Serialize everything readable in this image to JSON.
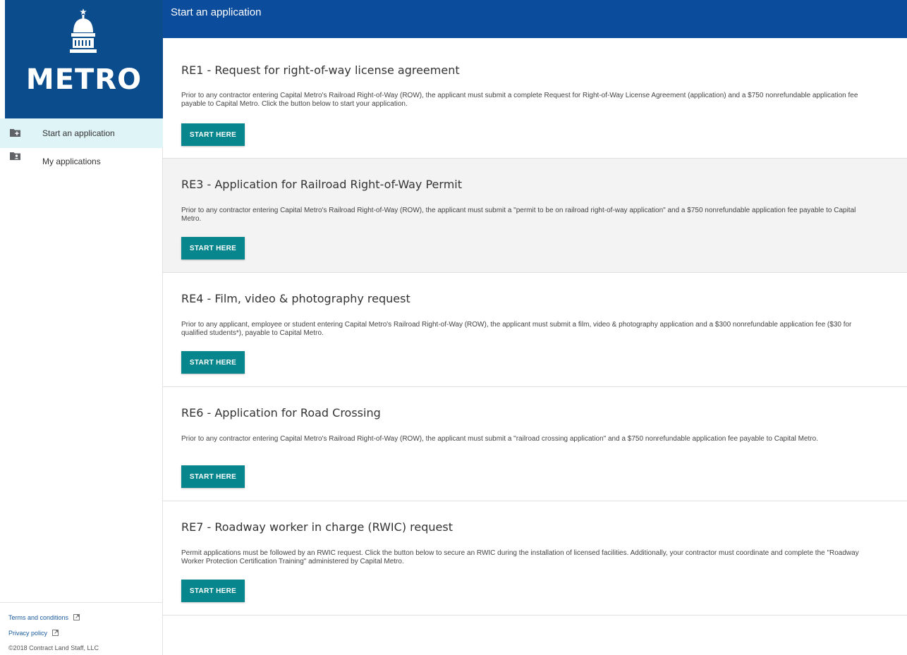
{
  "brand": {
    "logo_text": "METRO",
    "logo_color": "#0b4c8c"
  },
  "header": {
    "title": "Start an application",
    "color": "#0b4c9c"
  },
  "sidebar": {
    "items": [
      {
        "label": "Start an application",
        "icon": "folder-plus-icon",
        "active": true
      },
      {
        "label": "My applications",
        "icon": "folder-user-icon",
        "active": false
      }
    ],
    "footer": {
      "terms_label": "Terms and conditions",
      "privacy_label": "Privacy policy",
      "copyright": "©2018 Contract Land Staff, LLC"
    }
  },
  "applications": [
    {
      "title": "RE1 - Request for right-of-way license agreement",
      "description": "Prior to any contractor entering Capital Metro's Railroad Right-of-Way (ROW), the applicant must submit a complete Request for Right-of-Way License Agreement (application) and a $750 nonrefundable application fee payable to Capital Metro. Click the button below to start your application.",
      "button_label": "START HERE"
    },
    {
      "title": "RE3 - Application for Railroad Right-of-Way Permit",
      "description": "Prior to any contractor entering Capital Metro's Railroad Right-of-Way (ROW), the applicant must submit a \"permit to be on railroad right-of-way application\" and a $750 nonrefundable application fee payable to Capital Metro.",
      "button_label": "START HERE"
    },
    {
      "title": "RE4 - Film, video & photography request",
      "description": "Prior to any applicant, employee or student entering Capital Metro's Railroad Right-of-Way (ROW), the applicant must submit a film, video & photography application and a $300 nonrefundable application fee ($30 for qualified students*), payable to Capital Metro.",
      "button_label": "START HERE"
    },
    {
      "title": "RE6 - Application for Road Crossing",
      "description": "Prior to any contractor entering Capital Metro's Railroad Right-of-Way (ROW), the applicant must submit a \"railroad crossing application\" and a $750 nonrefundable application fee payable to Capital Metro.",
      "button_label": "START HERE"
    },
    {
      "title": "RE7 - Roadway worker in charge (RWIC) request",
      "description": "Permit applications must be followed by an RWIC request. Click the button below to secure an RWIC during the installation of licensed facilities. Additionally, your contractor must coordinate and complete the \"Roadway Worker Protection Certification Training\" administered by Capital Metro.",
      "button_label": "START HERE"
    }
  ],
  "colors": {
    "button": "#07868e",
    "active_nav": "#dff4f7"
  }
}
